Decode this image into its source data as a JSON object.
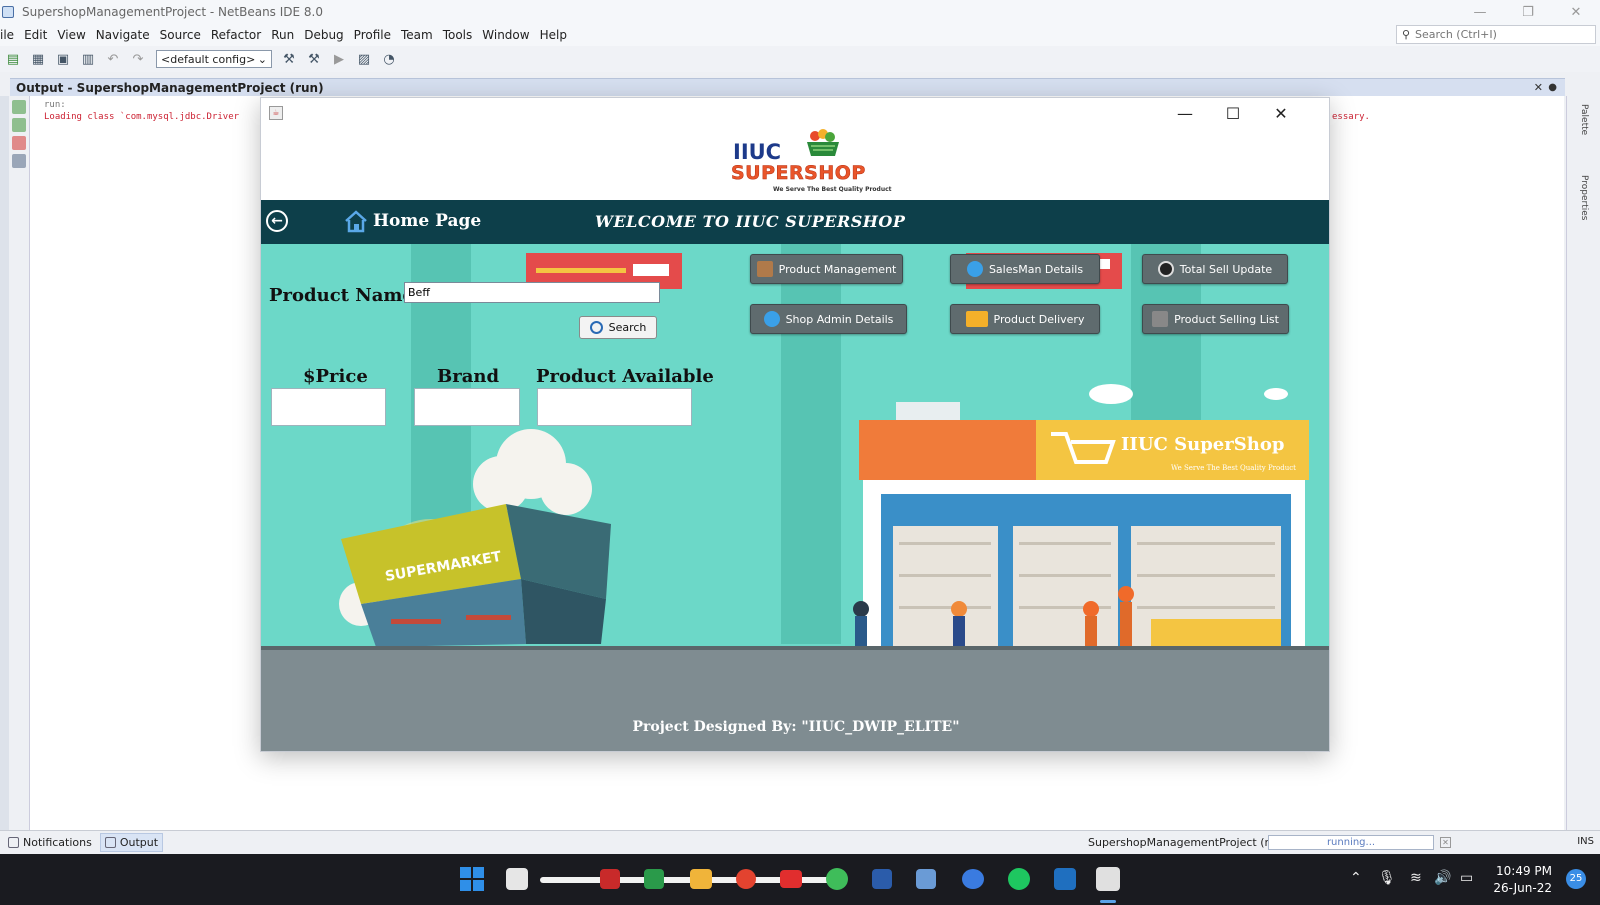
{
  "ide": {
    "title": "SupershopManagementProject - NetBeans IDE 8.0",
    "menu": [
      "ile",
      "Edit",
      "View",
      "Navigate",
      "Source",
      "Refactor",
      "Run",
      "Debug",
      "Profile",
      "Team",
      "Tools",
      "Window",
      "Help"
    ],
    "search_placeholder": "Search (Ctrl+I)",
    "config": "<default config>",
    "output_title": "Output - SupershopManagementProject (run)",
    "output_lines": [
      "run:",
      "Loading class `com.mysql.jdbc.Driver",
      "essary."
    ],
    "right_panels": [
      "Palette",
      "Properties"
    ],
    "status": {
      "tabs": [
        "Notifications",
        "Output"
      ],
      "project": "SupershopManagementProject (run)",
      "progress": "running...",
      "mode": "INS"
    }
  },
  "taskbar": {
    "time": "10:49 PM",
    "date": "26-Jun-22",
    "notifications": "25"
  },
  "app": {
    "logo": {
      "line1": "IIUC",
      "line2": "SUPERSHOP",
      "tagline": "We Serve The Best Quality Product"
    },
    "nav": {
      "home": "Home Page",
      "welcome": "WELCOME TO IIUC SUPERSHOP"
    },
    "product_name_label": "Product Name:",
    "product_name_value": "Beff",
    "search_label": "Search",
    "columns": [
      "$Price",
      "Brand",
      "Product Available"
    ],
    "buttons": [
      {
        "label": "Product Management",
        "icon": "box-icon"
      },
      {
        "label": "SalesMan Details",
        "icon": "user-icon"
      },
      {
        "label": "Total Sell Update",
        "icon": "refresh-icon"
      },
      {
        "label": "Shop Admin Details",
        "icon": "user-icon"
      },
      {
        "label": "Product Delivery",
        "icon": "truck-icon"
      },
      {
        "label": "Product Selling List",
        "icon": "list-icon"
      }
    ],
    "store_sign": "IIUC SuperShop",
    "store_tagline": "We Serve The Best Quality Product",
    "supermarket_sign": "SUPERMARKET",
    "footer": "Project Designed By: \"IIUC_DWIP_ELITE\""
  },
  "colors": {
    "nav_bg": "#0d3f4a",
    "scene_bg": "#6cd8c8",
    "button_bg": "#5f6b6e",
    "store_orange": "#f07b3a",
    "store_yellow": "#f4c542"
  }
}
